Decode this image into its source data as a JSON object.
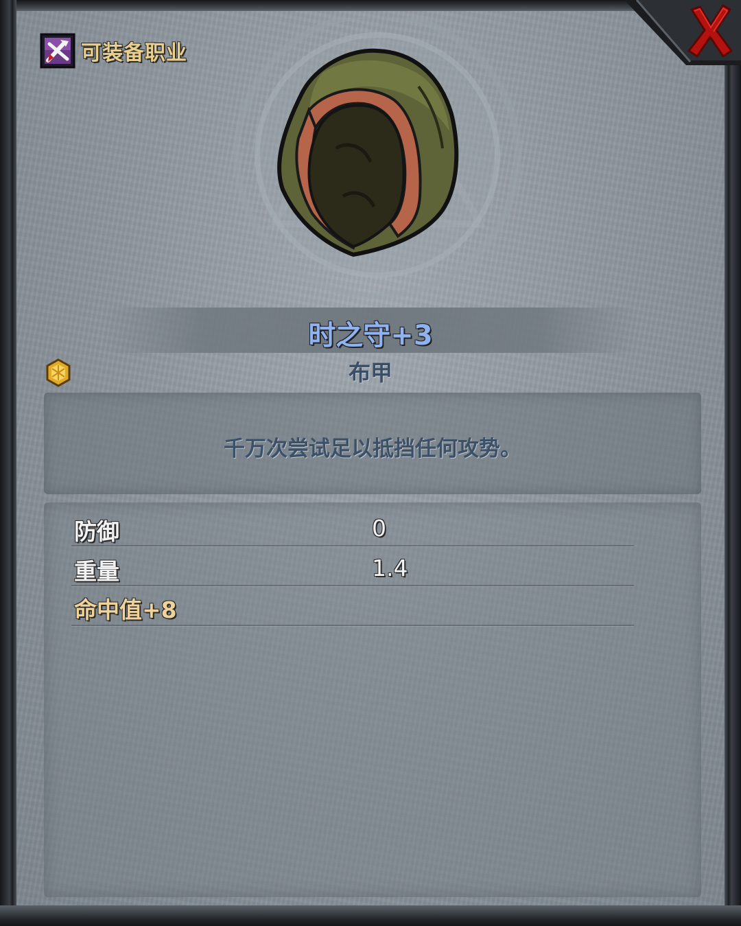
{
  "header": {
    "class_label": "可装备职业",
    "class_icon": "crossed-tools-icon"
  },
  "item": {
    "name": "时之守+3",
    "type": "布甲",
    "rarity_icon": "gold-hex-gem-icon",
    "image_icon": "green-hood-icon",
    "description": "千万次尝试足以抵挡任何攻势。"
  },
  "stats": [
    {
      "label": "防御",
      "value": "0"
    },
    {
      "label": "重量",
      "value": "1.4"
    }
  ],
  "bonuses": [
    "命中值+8"
  ],
  "controls": {
    "close_icon": "close-x-icon"
  },
  "colors": {
    "item_name": "#8fb3f0",
    "class_label": "#e8cf8e",
    "bonus": "#efd39a",
    "close": "#b3120f"
  }
}
